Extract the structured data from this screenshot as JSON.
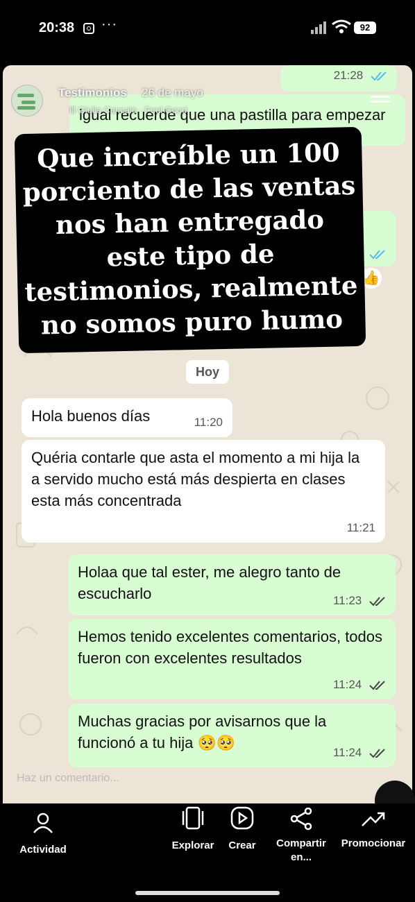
{
  "status_bar": {
    "time": "20:38",
    "battery": "92"
  },
  "story": {
    "header": {
      "name": "Testimonios",
      "date": "26 de mayo",
      "music": "Giulia Cancalo · Feel Good"
    },
    "bg_messages": [
      {
        "time": "21:28"
      },
      {
        "text": "igual recuerde que una pastilla para empezar con mo"
      }
    ],
    "caption": "Que increíble un 100 porciento de las ventas nos han entregado este tipo de testimonios, realmente no somos puro humo",
    "day_chip": "Hoy",
    "messages": [
      {
        "dir": "in",
        "text": "Hola buenos días",
        "time": "11:20"
      },
      {
        "dir": "in",
        "text": "Quéria contarle que asta el momento a mi hija la a servido mucho está más despierta en clases esta más concentrada",
        "time": "11:21"
      },
      {
        "dir": "out",
        "text": "Holaa que tal ester, me alegro tanto de escucharlo",
        "time": "11:23"
      },
      {
        "dir": "out",
        "text": "Hemos tenido excelentes comentarios, todos fueron con excelentes resultados",
        "time": "11:24"
      },
      {
        "dir": "out",
        "text": "Muchas gracias por avisarnos que la funcionó a tu hija 🥺🥺",
        "time": "11:24"
      }
    ],
    "comment_placeholder": "Haz un comentario..."
  },
  "nav": {
    "activity": "Actividad",
    "explore": "Explorar",
    "create": "Crear",
    "share": "Compartir en...",
    "promote": "Promocionar"
  },
  "colors": {
    "chat_bg": "#ece4d6",
    "bubble_in": "#ffffff",
    "bubble_out": "#d9fdd3",
    "ticks": "#53bdeb"
  }
}
